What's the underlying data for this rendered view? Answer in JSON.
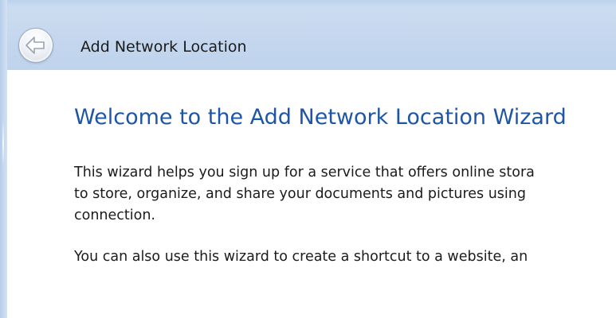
{
  "window": {
    "title": "Add Network Location"
  },
  "wizard": {
    "heading": "Welcome to the Add Network Location Wizard",
    "paragraph1": [
      "This wizard helps you sign up for a service that offers online stora",
      "to store, organize, and share your documents and pictures using",
      "connection."
    ],
    "paragraph2": "You can also use this wizard to create a shortcut to a website, an"
  },
  "icons": {
    "back": "back-arrow-icon"
  },
  "colors": {
    "title_bar": "#c3d6ee",
    "heading": "#1e56a6",
    "text": "#1b1b1b",
    "background": "#ffffff"
  }
}
